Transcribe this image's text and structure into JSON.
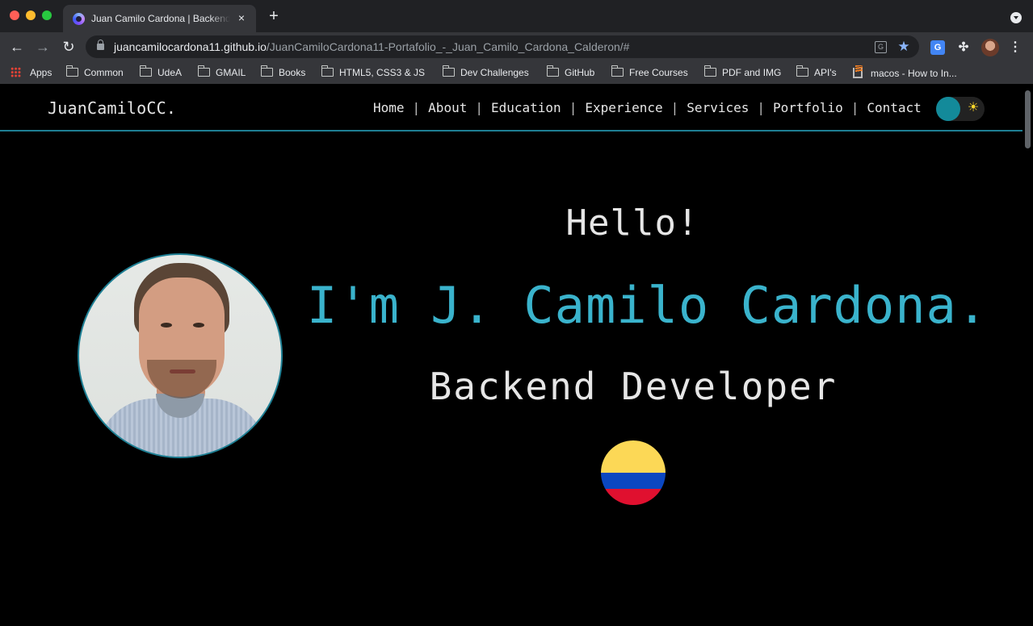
{
  "browser": {
    "tab_title": "Juan Camilo Cardona | Backend Developer",
    "tab_close": "×",
    "new_tab": "+",
    "url_host": "juancamilocardona11.github.io",
    "url_path": "/JuanCamiloCardona11-Portafolio_-_Juan_Camilo_Cardona_Calderon/#",
    "bookmarks": [
      {
        "label": "Apps",
        "icon": "apps-grid-icon"
      },
      {
        "label": "Common",
        "icon": "folder-icon"
      },
      {
        "label": "UdeA",
        "icon": "folder-icon"
      },
      {
        "label": "GMAIL",
        "icon": "folder-icon"
      },
      {
        "label": "Books",
        "icon": "folder-icon"
      },
      {
        "label": "HTML5, CSS3 & JS",
        "icon": "folder-icon"
      },
      {
        "label": "Dev Challenges",
        "icon": "folder-icon"
      },
      {
        "label": "GitHub",
        "icon": "folder-icon"
      },
      {
        "label": "Free Courses",
        "icon": "folder-icon"
      },
      {
        "label": "PDF and IMG",
        "icon": "folder-icon"
      },
      {
        "label": "API's",
        "icon": "folder-icon"
      },
      {
        "label": "macos - How to In...",
        "icon": "stackoverflow-icon"
      }
    ]
  },
  "site": {
    "brand": "JuanCamiloCC.",
    "nav": [
      {
        "label": "Home"
      },
      {
        "label": "About"
      },
      {
        "label": "Education"
      },
      {
        "label": "Experience"
      },
      {
        "label": "Services"
      },
      {
        "label": "Portfolio"
      },
      {
        "label": "Contact"
      }
    ],
    "nav_separator": "|",
    "theme_icon": "☀",
    "hero": {
      "greeting": "Hello!",
      "name": "I'm J. Camilo Cardona.",
      "role": "Backend Developer",
      "flag": "colombia-flag"
    },
    "colors": {
      "accent": "#3ab3cc",
      "header_border": "#1e7f94",
      "background": "#000000"
    }
  }
}
